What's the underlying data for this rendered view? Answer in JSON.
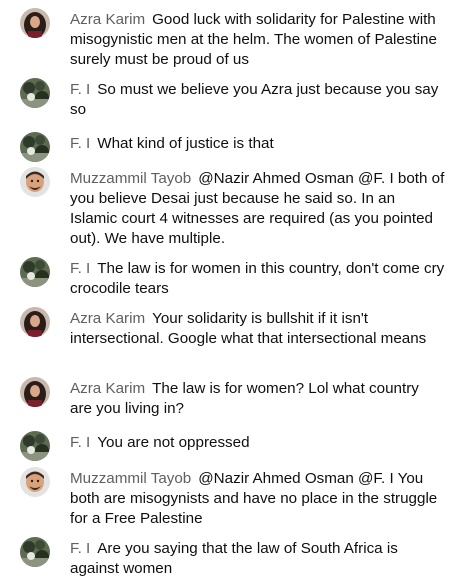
{
  "avatars": {
    "Azra Karim": "woman-avatar-icon",
    "F. I": "landscape-avatar-icon",
    "Muzzammil Tayob": "cartoon-man-avatar-icon"
  },
  "colors": {
    "author": "#606060",
    "text": "#0f0f0f",
    "background": "#ffffff"
  },
  "comments": [
    {
      "author": "Azra Karim",
      "text": "Good luck with solidarity for Palestine with misogynistic men at the helm. The women of Palestine surely must be proud of us"
    },
    {
      "author": "F. I",
      "text": "So must we believe you Azra just because you say so"
    },
    {
      "author": "F. I",
      "text": "What kind of justice is that"
    },
    {
      "author": "Muzzammil Tayob",
      "text": "@Nazir Ahmed Osman @F. I both of you believe Desai just because he said so. In an Islamic court 4 witnesses are required (as you pointed out). We have multiple."
    },
    {
      "author": "F. I",
      "text": "The law is for women in this country, don't come cry crocodile tears"
    },
    {
      "author": "Azra Karim",
      "text": "Your solidarity is bullshit if it isn't intersectional. Google what that intersectional means"
    },
    {
      "author": "Azra Karim",
      "text": "The law is for women? Lol what country are you living in?"
    },
    {
      "author": "F. I",
      "text": "You are not oppressed"
    },
    {
      "author": "Muzzammil Tayob",
      "text": "@Nazir Ahmed Osman @F. I You both are misogynists and have no place in the struggle for a Free Palestine"
    },
    {
      "author": "F. I",
      "text": "Are you saying that the law of South Africa is against women"
    }
  ]
}
